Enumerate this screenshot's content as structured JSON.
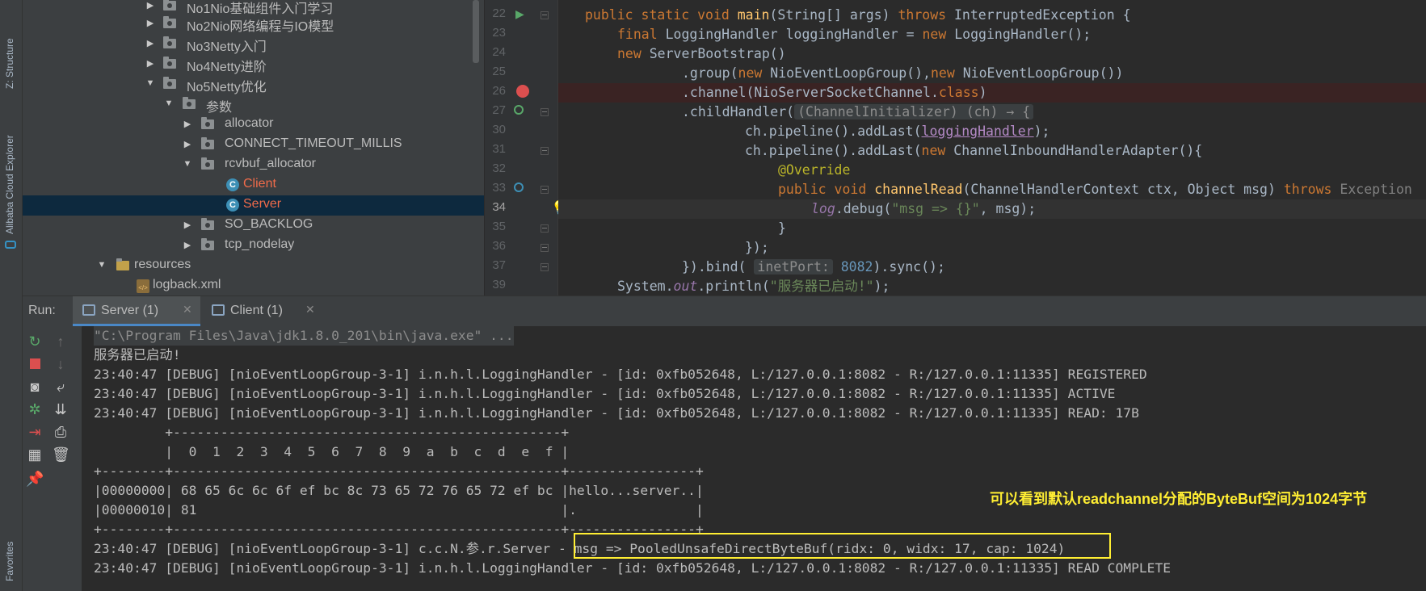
{
  "left_strip": {
    "tabs": [
      "Z: Structure",
      "Alibaba Cloud Explorer",
      "Favorites"
    ]
  },
  "tree": {
    "items": [
      {
        "label": "No1Nio基础组件入门学习",
        "icon": "package-icon",
        "state": "collapsed"
      },
      {
        "label": "No2Nio网络编程与IO模型",
        "icon": "package-icon",
        "state": "collapsed"
      },
      {
        "label": "No3Netty入门",
        "icon": "package-icon",
        "state": "collapsed"
      },
      {
        "label": "No4Netty进阶",
        "icon": "package-icon",
        "state": "collapsed"
      },
      {
        "label": "No5Netty优化",
        "icon": "package-icon",
        "state": "expanded"
      },
      {
        "label": "参数",
        "icon": "package-icon",
        "state": "expanded"
      },
      {
        "label": "allocator",
        "icon": "package-icon",
        "state": "collapsed"
      },
      {
        "label": "CONNECT_TIMEOUT_MILLIS",
        "icon": "package-icon",
        "state": "collapsed"
      },
      {
        "label": "rcvbuf_allocator",
        "icon": "package-icon",
        "state": "expanded"
      },
      {
        "label": "Client",
        "icon": "class-icon",
        "state": "leaf"
      },
      {
        "label": "Server",
        "icon": "class-icon",
        "state": "leaf",
        "selected": true
      },
      {
        "label": "SO_BACKLOG",
        "icon": "package-icon",
        "state": "collapsed"
      },
      {
        "label": "tcp_nodelay",
        "icon": "package-icon",
        "state": "collapsed"
      },
      {
        "label": "resources",
        "icon": "folder-icon",
        "state": "expanded"
      },
      {
        "label": "logback.xml",
        "icon": "xml-file-icon",
        "state": "leaf"
      }
    ]
  },
  "editor": {
    "lines": [
      {
        "n": "22",
        "t": [
          "public static void ",
          "main",
          "(String[] args) ",
          "throws ",
          "InterruptedException {"
        ]
      },
      {
        "n": "23",
        "t": [
          "final ",
          "LoggingHandler loggingHandler = ",
          "new ",
          "LoggingHandler();"
        ]
      },
      {
        "n": "24",
        "t": [
          "new ",
          "ServerBootstrap()"
        ]
      },
      {
        "n": "25",
        "t": [
          ".group(",
          "new ",
          "NioEventLoopGroup(),",
          "new ",
          "NioEventLoopGroup())"
        ]
      },
      {
        "n": "26",
        "t": [
          ".channel(NioServerSocketChannel.",
          "class",
          ")"
        ]
      },
      {
        "n": "27",
        "t": [
          ".childHandler(",
          "(ChannelInitializer) (ch) → {"
        ]
      },
      {
        "n": "30",
        "t": [
          "ch.pipeline().addLast(",
          "loggingHandler",
          ");"
        ]
      },
      {
        "n": "31",
        "t": [
          "ch.pipeline().addLast(",
          "new ",
          "ChannelInboundHandlerAdapter(){"
        ]
      },
      {
        "n": "32",
        "t": [
          "@Override"
        ]
      },
      {
        "n": "33",
        "t": [
          "public void ",
          "channelRead",
          "(ChannelHandlerContext ctx, Object msg) ",
          "throws ",
          "Exception"
        ]
      },
      {
        "n": "34",
        "t": [
          "log",
          ".debug(",
          "\"msg => {}\"",
          ", msg);"
        ]
      },
      {
        "n": "35",
        "t": [
          "}"
        ]
      },
      {
        "n": "36",
        "t": [
          "});"
        ]
      },
      {
        "n": "37",
        "t": [
          "}).bind( ",
          "inetPort:",
          " 8082",
          ").sync();"
        ]
      },
      {
        "n": "39",
        "t": [
          "System.",
          "out",
          ".println(",
          "\"服务器已启动!\"",
          ");"
        ]
      }
    ]
  },
  "run": {
    "label": "Run:",
    "tabs": [
      {
        "label": "Server (1)",
        "active": true
      },
      {
        "label": "Client (1)",
        "active": false
      }
    ]
  },
  "console": {
    "lines": [
      "\"C:\\Program Files\\Java\\jdk1.8.0_201\\bin\\java.exe\" ...",
      "服务器已启动!",
      "23:40:47 [DEBUG] [nioEventLoopGroup-3-1] i.n.h.l.LoggingHandler - [id: 0xfb052648, L:/127.0.0.1:8082 - R:/127.0.0.1:11335] REGISTERED",
      "23:40:47 [DEBUG] [nioEventLoopGroup-3-1] i.n.h.l.LoggingHandler - [id: 0xfb052648, L:/127.0.0.1:8082 - R:/127.0.0.1:11335] ACTIVE",
      "23:40:47 [DEBUG] [nioEventLoopGroup-3-1] i.n.h.l.LoggingHandler - [id: 0xfb052648, L:/127.0.0.1:8082 - R:/127.0.0.1:11335] READ: 17B",
      "         +-------------------------------------------------+",
      "         |  0  1  2  3  4  5  6  7  8  9  a  b  c  d  e  f |",
      "+--------+-------------------------------------------------+----------------+",
      "|00000000| 68 65 6c 6c 6f ef bc 8c 73 65 72 76 65 72 ef bc |hello...server..|",
      "|00000010| 81                                              |.               |",
      "+--------+-------------------------------------------------+----------------+",
      "23:40:47 [DEBUG] [nioEventLoopGroup-3-1] c.c.N.参.r.Server - msg => PooledUnsafeDirectByteBuf(ridx: 0, widx: 17, cap: 1024)",
      "23:40:47 [DEBUG] [nioEventLoopGroup-3-1] i.n.h.l.LoggingHandler - [id: 0xfb052648, L:/127.0.0.1:8082 - R:/127.0.0.1:11335] READ COMPLETE"
    ]
  },
  "annotation": {
    "text": "可以看到默认readchannel分配的ByteBuf空间为1024字节",
    "color": "#ffee33"
  },
  "colors": {
    "keyword": "#cc7832",
    "function": "#ffc66d",
    "string": "#6a8759",
    "number": "#6897bb",
    "selection": "#0d293e"
  }
}
